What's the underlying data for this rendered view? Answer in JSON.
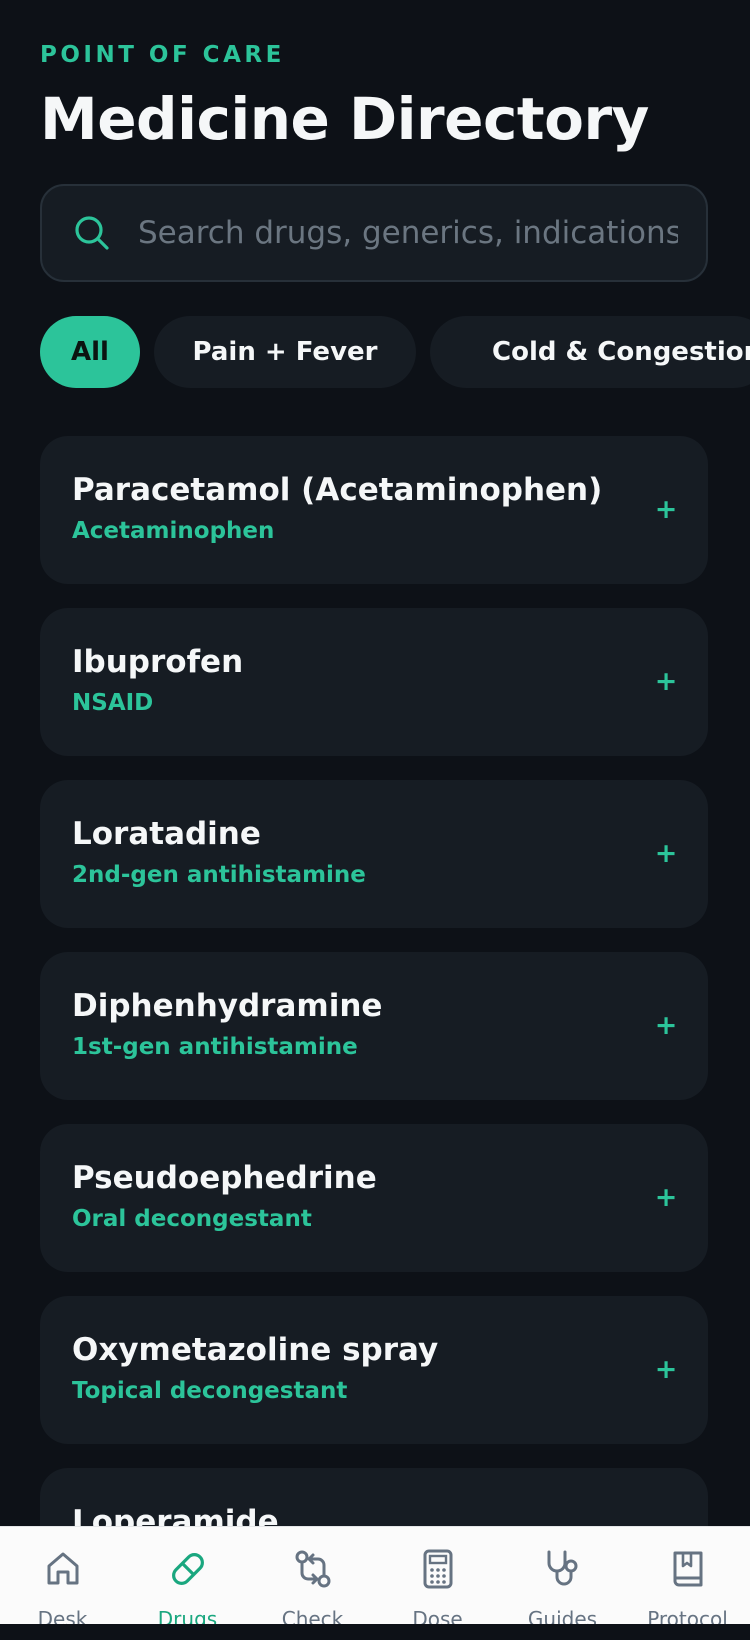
{
  "header": {
    "eyebrow": "POINT OF CARE",
    "title": "Medicine Directory"
  },
  "search": {
    "placeholder": "Search drugs, generics, indications...",
    "value": ""
  },
  "filters": [
    {
      "label": "All",
      "active": true
    },
    {
      "label": "Pain + Fever",
      "active": false
    },
    {
      "label": "Cold & Congestion",
      "active": false
    }
  ],
  "medicines": [
    {
      "name": "Paracetamol (Acetaminophen)",
      "category": "Acetaminophen",
      "action": "+"
    },
    {
      "name": "Ibuprofen",
      "category": "NSAID",
      "action": "+"
    },
    {
      "name": "Loratadine",
      "category": "2nd-gen antihistamine",
      "action": "+"
    },
    {
      "name": "Diphenhydramine",
      "category": "1st-gen antihistamine",
      "action": "+"
    },
    {
      "name": "Pseudoephedrine",
      "category": "Oral decongestant",
      "action": "+"
    },
    {
      "name": "Oxymetazoline spray",
      "category": "Topical decongestant",
      "action": "+"
    },
    {
      "name": "Loperamide",
      "category": "",
      "action": ""
    }
  ],
  "nav": [
    {
      "label": "Desk",
      "icon": "home-icon",
      "active": false
    },
    {
      "label": "Drugs",
      "icon": "pill-icon",
      "active": true
    },
    {
      "label": "Check",
      "icon": "interaction-check-icon",
      "active": false
    },
    {
      "label": "Dose",
      "icon": "calculator-icon",
      "active": false
    },
    {
      "label": "Guides",
      "icon": "stethoscope-icon",
      "active": false
    },
    {
      "label": "Protocol",
      "icon": "book-icon",
      "active": false
    }
  ],
  "colors": {
    "background": "#0d1117",
    "surface": "#161c23",
    "accent": "#2cc49a",
    "nav_background": "#fbfbfb",
    "nav_inactive": "#667382"
  }
}
